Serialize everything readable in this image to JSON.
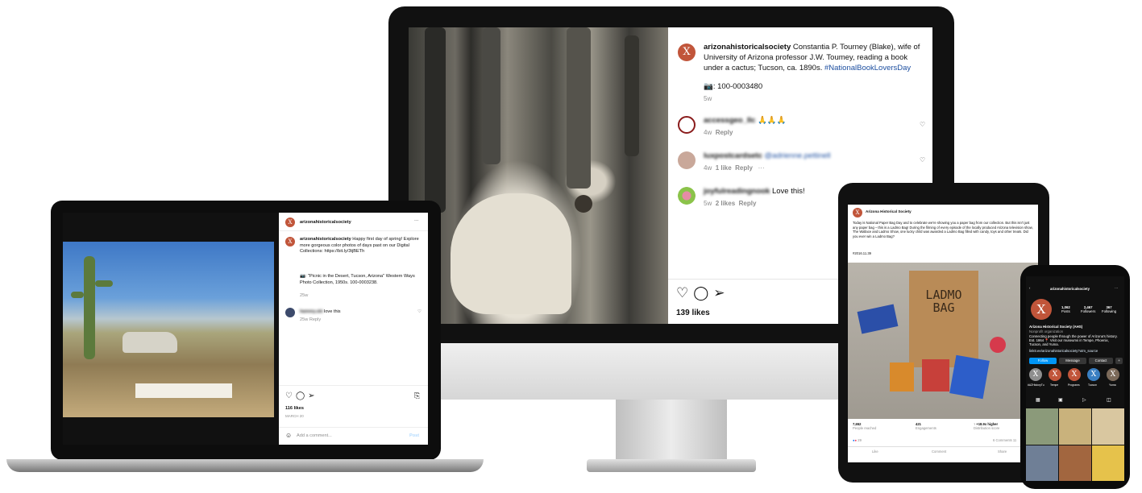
{
  "monitor_post": {
    "username": "arizonahistoricalsociety",
    "caption": "Constantia P. Tourney (Blake), wife of University of Arizona professor J.W. Toumey, reading a book under a cactus; Tucson, ca. 1890s.",
    "hashtag": "#NationalBookLoversDay",
    "camera_icon": "📷",
    "photo_id": "100-0003480",
    "age": "5w",
    "comments": [
      {
        "user": "accessgeo_llc",
        "text": "🙏🙏🙏",
        "meta_time": "4w",
        "meta_likes": "",
        "meta_reply": "Reply"
      },
      {
        "user": "luxpostcardsetc",
        "text": "@adrienne.pettinell",
        "meta_time": "4w",
        "meta_likes": "1 like",
        "meta_reply": "Reply"
      },
      {
        "user": "joyfulreadingnook",
        "text": "Love this!",
        "meta_time": "5w",
        "meta_likes": "2 likes",
        "meta_reply": "Reply"
      }
    ],
    "likes": "139 likes"
  },
  "laptop_post": {
    "username": "arizonahistoricalsociety",
    "more": "···",
    "caption": "Happy first day of spring! Explore more gorgeous color photos of days past on our Digital Collections: https://bit.ly/3tjBETh",
    "camera_line": "📷: \"Picnic in the Desert, Tucson, Arizona\" Western Ways Photo Collection, 1950s. 100-0003238.",
    "age": "25w",
    "comment_user": "hammy.ski",
    "comment_text": "love this",
    "comment_meta": "25w  Reply",
    "likes": "116 likes",
    "date": "MARCH 20",
    "add_comment": "Add a comment...",
    "post_button": "Post"
  },
  "tablet_post": {
    "page_name": "Arizona Historical Society",
    "body": "Today is National Paper Bag Day and to celebrate we're showing you a paper bag from our collection. But this isn't just any paper bag – this is a Ladmo Bag! During the filming of every episode of the locally produced Arizona television show, The Wallace and Ladmo Show, one lucky child was awarded a Ladmo Bag filled with candy, toys and other treats. Did you ever win a Ladmo Bag?",
    "tag": "#2016.11.39",
    "bag_label_1": "LADMO",
    "bag_label_2": "BAG",
    "stats": [
      {
        "value": "7,652",
        "label": "People reached"
      },
      {
        "value": "421",
        "label": "Engagements"
      },
      {
        "value": "↑ +18.9x higher",
        "label": "Distribution score"
      }
    ],
    "reactions": "29",
    "comments_count": "6 Comments  11",
    "actions": [
      "Like",
      "Comment",
      "Share"
    ]
  },
  "phone_profile": {
    "username": "arizonahistoricalsociety",
    "posts_value": "1,062",
    "posts_label": "Posts",
    "followers_value": "2,467",
    "followers_label": "Followers",
    "following_value": "367",
    "following_label": "Following",
    "full_name": "Arizona Historical Society (AHS)",
    "category": "Nonprofit organization",
    "bio": "Connecting people through the power of Arizona's history. Est. 1864 📍 Visit our museums in Tempe, Phoenix, Tucson, and Yuma.",
    "link": "linktr.ee/arizonahistoricalsociety?utm_source",
    "buttons": [
      "Follow",
      "Message",
      "Contact"
    ],
    "highlights": [
      "#AZHistoryTu",
      "Tempe",
      "Programs",
      "Tucson",
      "Yuma"
    ]
  },
  "colors": {
    "brand_orange": "#c1553a",
    "link_blue": "#1d4fa0",
    "ig_blue": "#0095f6"
  }
}
